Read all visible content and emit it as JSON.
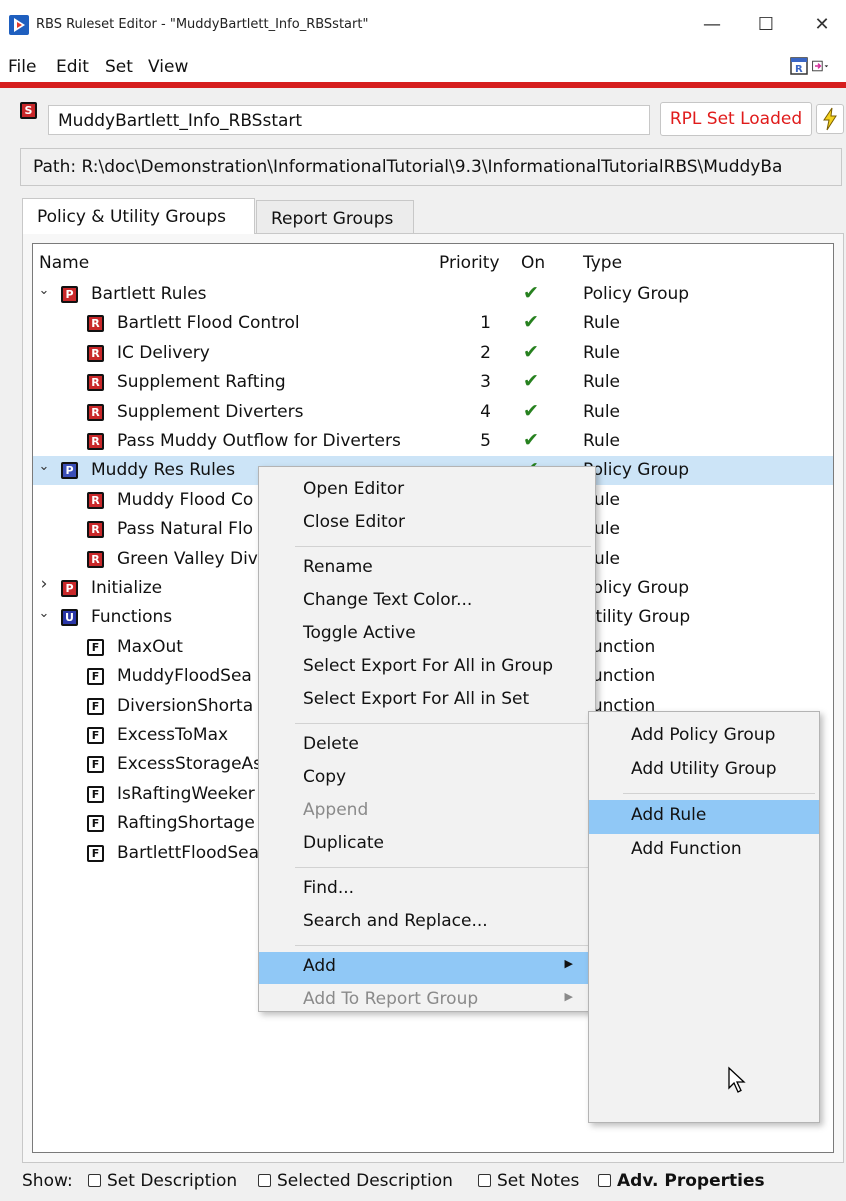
{
  "window": {
    "title": "RBS Ruleset Editor - \"MuddyBartlett_Info_RBSstart\""
  },
  "menu": [
    "File",
    "Edit",
    "Set",
    "View"
  ],
  "set": {
    "name": "MuddyBartlett_Info_RBSstart",
    "status": "RPL Set Loaded"
  },
  "path": "Path:  R:\\doc\\Demonstration\\InformationalTutorial\\9.3\\InformationalTutorialRBS\\MuddyBa",
  "tabs": [
    "Policy & Utility Groups",
    "Report Groups"
  ],
  "columns": {
    "name": "Name",
    "priority": "Priority",
    "on": "On",
    "type": "Type"
  },
  "tree": [
    {
      "name": "Bartlett Rules",
      "priority": "",
      "on": true,
      "type": "Policy Group",
      "icon": "P",
      "level": 0,
      "expand": "down"
    },
    {
      "name": "Bartlett Flood Control",
      "priority": "1",
      "on": true,
      "type": "Rule",
      "icon": "R",
      "level": 1
    },
    {
      "name": "IC Delivery",
      "priority": "2",
      "on": true,
      "type": "Rule",
      "icon": "R",
      "level": 1
    },
    {
      "name": "Supplement Rafting",
      "priority": "3",
      "on": true,
      "type": "Rule",
      "icon": "R",
      "level": 1
    },
    {
      "name": "Supplement Diverters",
      "priority": "4",
      "on": true,
      "type": "Rule",
      "icon": "R",
      "level": 1
    },
    {
      "name": "Pass Muddy Outflow for Diverters",
      "priority": "5",
      "on": true,
      "type": "Rule",
      "icon": "R",
      "level": 1
    },
    {
      "name": "Muddy Res Rules",
      "priority": "",
      "on": true,
      "type": "Policy Group",
      "icon": "PB",
      "level": 0,
      "expand": "down",
      "selected": true
    },
    {
      "name": "Muddy Flood Co",
      "priority": "",
      "on": false,
      "type": "Rule",
      "icon": "R",
      "level": 1
    },
    {
      "name": "Pass Natural Flo",
      "priority": "",
      "on": false,
      "type": "Rule",
      "icon": "R",
      "level": 1
    },
    {
      "name": "Green Valley Div",
      "priority": "",
      "on": false,
      "type": "Rule",
      "icon": "R",
      "level": 1
    },
    {
      "name": "Initialize",
      "priority": "",
      "on": false,
      "type": "Policy Group",
      "icon": "P",
      "level": 0,
      "expand": "right"
    },
    {
      "name": "Functions",
      "priority": "",
      "on": false,
      "type": "Utility Group",
      "icon": "U",
      "level": 0,
      "expand": "down"
    },
    {
      "name": "MaxOut",
      "priority": "",
      "on": false,
      "type": "Function",
      "icon": "F",
      "level": 1
    },
    {
      "name": "MuddyFloodSea",
      "priority": "",
      "on": false,
      "type": "Function",
      "icon": "F",
      "level": 1
    },
    {
      "name": "DiversionShorta",
      "priority": "",
      "on": false,
      "type": "Function",
      "icon": "F",
      "level": 1
    },
    {
      "name": "ExcessToMax",
      "priority": "",
      "on": false,
      "type": "Function",
      "icon": "F",
      "level": 1
    },
    {
      "name": "ExcessStorageAs",
      "priority": "",
      "on": false,
      "type": "Function",
      "icon": "F",
      "level": 1
    },
    {
      "name": "IsRaftingWeeker",
      "priority": "",
      "on": false,
      "type": "Function",
      "icon": "F",
      "level": 1
    },
    {
      "name": "RaftingShortage",
      "priority": "",
      "on": false,
      "type": "Function",
      "icon": "F",
      "level": 1
    },
    {
      "name": "BartlettFloodSea",
      "priority": "",
      "on": false,
      "type": "Function",
      "icon": "F",
      "level": 1
    }
  ],
  "context_menu": [
    {
      "label": "Open Editor"
    },
    {
      "label": "Close Editor"
    },
    {
      "sep": true
    },
    {
      "label": "Rename"
    },
    {
      "label": "Change Text Color..."
    },
    {
      "label": "Toggle Active"
    },
    {
      "label": "Select Export For All in Group"
    },
    {
      "label": "Select Export For All in Set"
    },
    {
      "sep": true
    },
    {
      "label": "Delete"
    },
    {
      "label": "Copy"
    },
    {
      "label": "Append",
      "disabled": true
    },
    {
      "label": "Duplicate"
    },
    {
      "sep": true
    },
    {
      "label": "Find..."
    },
    {
      "label": "Search and Replace..."
    },
    {
      "sep": true
    },
    {
      "label": "Add",
      "submenu": true,
      "highlighted": true
    },
    {
      "label": "Add To Report Group",
      "submenu": true,
      "disabled": true
    }
  ],
  "submenu": [
    {
      "label": "Add Policy Group"
    },
    {
      "label": "Add Utility Group"
    },
    {
      "sep": true
    },
    {
      "label": "Add Rule",
      "highlighted": true
    },
    {
      "label": "Add Function"
    }
  ],
  "show": {
    "label": "Show:",
    "options": [
      "Set Description",
      "Selected Description",
      "Set Notes",
      "Adv. Properties"
    ]
  },
  "colors": {
    "accent_red": "#d61e1e",
    "selection": "#cce4f7",
    "menu_highlight": "#90c8f6",
    "check": "#27811f"
  }
}
